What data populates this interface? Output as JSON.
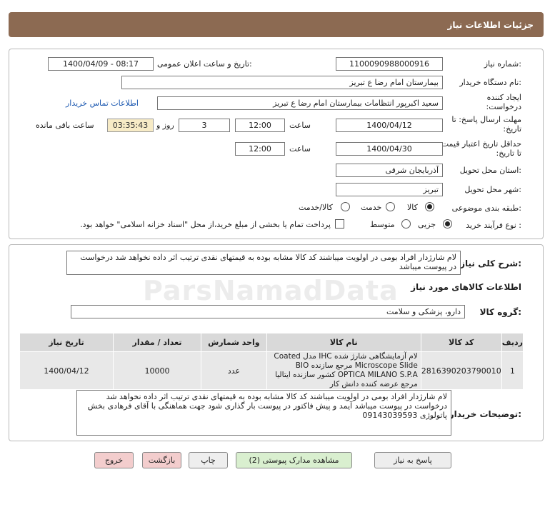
{
  "header": {
    "title": "جزئیات اطلاعات نیاز"
  },
  "form": {
    "need_number_label": "شماره نیاز:",
    "need_number": "1100090988000916",
    "announce_label": "تاریخ و ساعت اعلان عمومی:",
    "announce_value": "1400/04/09 - 08:17",
    "buyer_org_label": "نام دستگاه خریدار:",
    "buyer_org": "بیمارستان امام رضا  ع  تبریز",
    "creator_label": "ایجاد کننده درخواست:",
    "creator": "سعید اکبرپور انتظامات بیمارستان امام رضا  ع  تبریز",
    "contact_link": "اطلاعات تماس خریدار",
    "deadline_label": "مهلت ارسال پاسخ: تا تاریخ:",
    "deadline_date": "1400/04/12",
    "time_label": "ساعت",
    "deadline_time": "12:00",
    "days_value": "3",
    "days_label": "روز و",
    "remaining_time": "03:35:43",
    "remaining_label": "ساعت باقی مانده",
    "validity_label": "حداقل تاریخ اعتبار قیمت: تا تاریخ:",
    "validity_date": "1400/04/30",
    "validity_time": "12:00",
    "province_label": "استان محل تحویل:",
    "province": "آذربایجان شرقی",
    "city_label": "شهر محل تحویل:",
    "city": "تبریز",
    "category_label": "طبقه بندی موضوعی:",
    "category_options": [
      "کالا",
      "خدمت",
      "کالا/خدمت"
    ],
    "category_selected": "کالا",
    "process_label": "نوع فرآیند خرید :",
    "process_options": [
      "جزیی",
      "متوسط"
    ],
    "process_selected": "جزیی",
    "payment_note": "پرداخت تمام یا بخشی از مبلغ خرید،از محل \"اسناد خزانه اسلامی\" خواهد بود."
  },
  "description": {
    "label": "شرح کلی نیاز:",
    "text": "لام شارژدار افراد بومی در اولویت میباشند کد کالا مشابه بوده به قیمتهای نقدی ترتیب اثر داده نخواهد شد درخواست در پیوست میباشد"
  },
  "goods": {
    "section_title": "اطلاعات کالاهای مورد نیاز",
    "group_label": "گروه کالا:",
    "group_value": "دارو، پزشکی و سلامت",
    "columns": [
      "ردیف",
      "کد کالا",
      "نام کالا",
      "واحد شمارش",
      "تعداد / مقدار",
      "تاریخ نیاز"
    ],
    "rows": [
      {
        "row": "1",
        "code": "2816390203790010",
        "name": "لام آزمایشگاهی شارژ شده IHC مدل Coated Microscope Slide مرجع سازنده BIO OPTICA MILANO S.P.A کشور سازنده ایتالیا مرجع عرضه کننده دانش کار",
        "unit": "عدد",
        "qty": "10000",
        "date": "1400/04/12"
      }
    ]
  },
  "buyer_notes": {
    "label": "توضیحات خریدار:",
    "text": "لام شارژدار افراد بومی در اولویت میباشند کد کالا مشابه بوده به قیمتهای نقدی ترتیب اثر داده نخواهد شد درخواست در پیوست میباشد آیمد و پیش فاکتور در پیوست بار گذاری شود جهت هماهنگی با آقای فرهادی بخش پاتولوژی 09143039593"
  },
  "buttons": {
    "reply": "پاسخ به نیاز",
    "attachments": "مشاهده مدارک پیوستی (2)",
    "print": "چاپ",
    "back": "بازگشت",
    "exit": "خروج"
  },
  "watermark": "ParsNamadData"
}
